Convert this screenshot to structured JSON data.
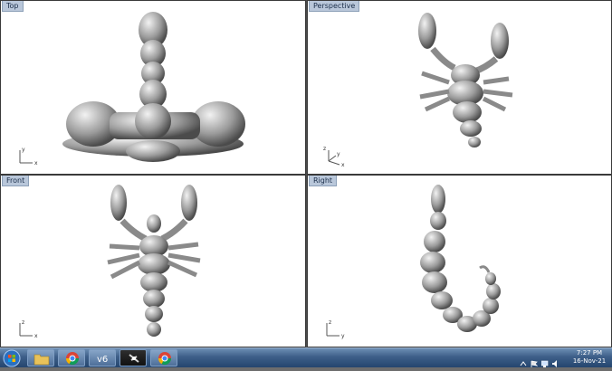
{
  "viewports": {
    "top": {
      "label": "Top",
      "axis_v": "y",
      "axis_h": "x"
    },
    "perspective": {
      "label": "Perspective",
      "axis_v": "z",
      "axis_h": "x",
      "axis_d": "y"
    },
    "front": {
      "label": "Front",
      "axis_v": "z",
      "axis_h": "x"
    },
    "right": {
      "label": "Right",
      "axis_v": "z",
      "axis_h": "y"
    }
  },
  "taskbar": {
    "buttons": [
      {
        "name": "start-orb-icon"
      },
      {
        "name": "file-explorer-icon"
      },
      {
        "name": "chrome-icon"
      },
      {
        "name": "v6-app-icon",
        "label": "v6"
      },
      {
        "name": "rhino-scorpion-icon"
      },
      {
        "name": "chrome-icon-2"
      }
    ],
    "time": "7:27 PM",
    "date": "16-Nov-21"
  },
  "colors": {
    "viewport_bg": "#ffffff",
    "taskbar": "#3d5e88",
    "model": "#9a9a9a"
  }
}
